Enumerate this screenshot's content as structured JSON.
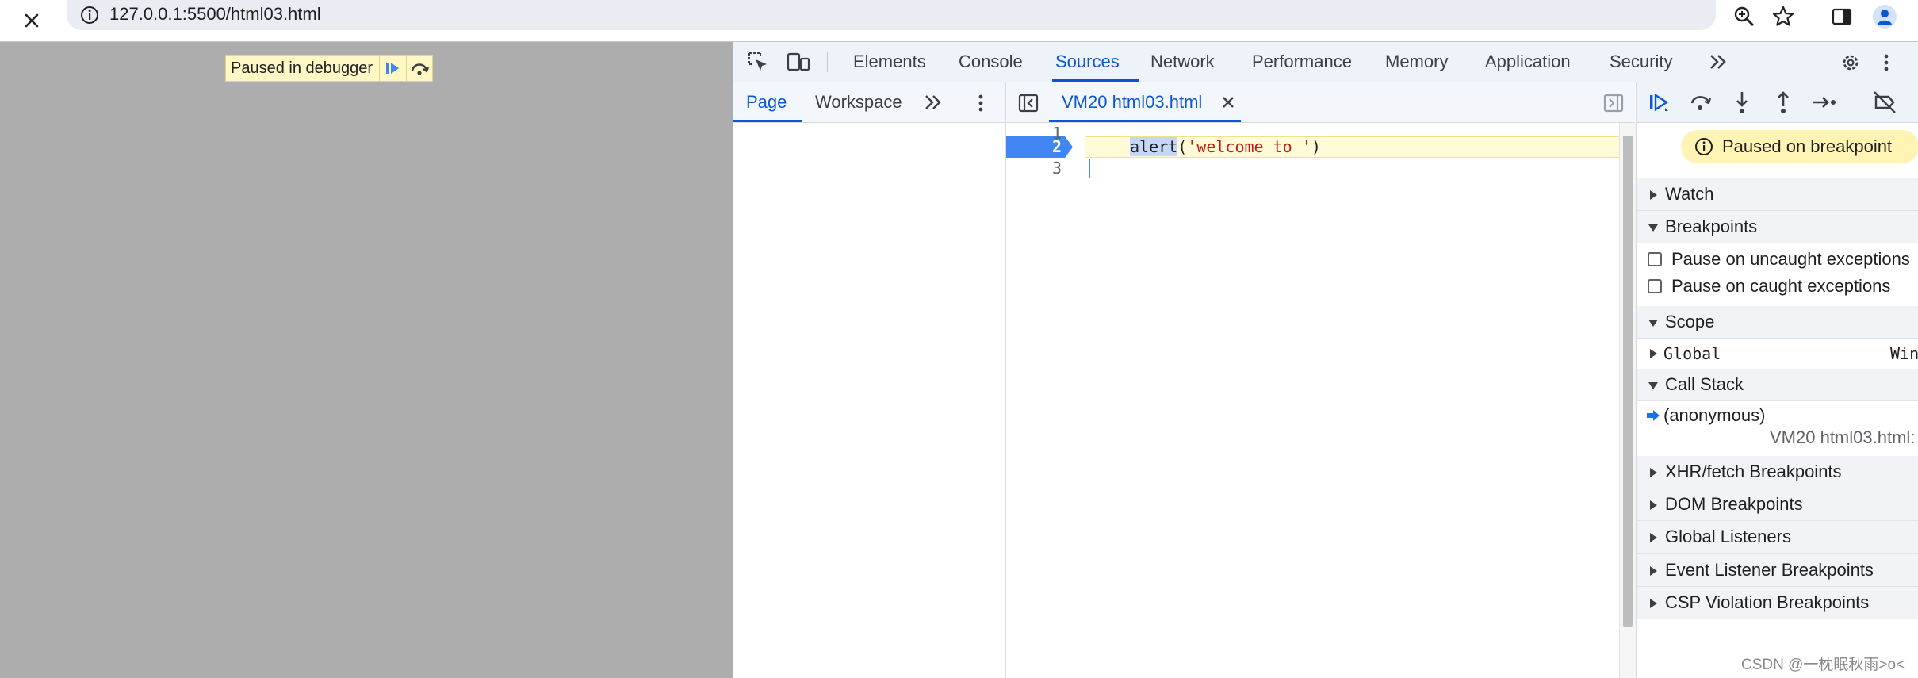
{
  "browser": {
    "url": "127.0.0.1:5500/html03.html",
    "icons": [
      "close-icon",
      "info-icon",
      "zoom-icon",
      "bookmark-star-icon",
      "side-panel-icon",
      "profile-avatar-icon"
    ]
  },
  "page": {
    "overlay_text": "Paused in debugger",
    "background": "#adadad"
  },
  "devtools": {
    "tabs": [
      "Elements",
      "Console",
      "Sources",
      "Network",
      "Performance",
      "Memory",
      "Application",
      "Security"
    ],
    "active_tab": "Sources",
    "accent": "#0b57d0",
    "navigator": {
      "tabs": [
        "Page",
        "Workspace"
      ],
      "active": "Page"
    },
    "editor": {
      "file_tab": "VM20 html03.html",
      "line_numbers": [
        "1",
        "2",
        "3"
      ],
      "active_line": "2",
      "code_fn": "alert",
      "code_open": "(",
      "code_str": "'welcome to '",
      "code_close": ")"
    },
    "sidebar": {
      "paused_banner": "Paused on breakpoint",
      "watch": "Watch",
      "breakpoints": "Breakpoints",
      "pause_uncaught": "Pause on uncaught exceptions",
      "pause_caught": "Pause on caught exceptions",
      "scope": "Scope",
      "global_label": "Global",
      "global_value": "Win",
      "call_stack": "Call Stack",
      "frame_name": "(anonymous)",
      "frame_location": "VM20 html03.html:",
      "xhr": "XHR/fetch Breakpoints",
      "dom": "DOM Breakpoints",
      "global_listeners": "Global Listeners",
      "event_listener": "Event Listener Breakpoints",
      "csp": "CSP Violation Breakpoints"
    }
  },
  "watermark": "CSDN @一枕眠秋雨>o<"
}
